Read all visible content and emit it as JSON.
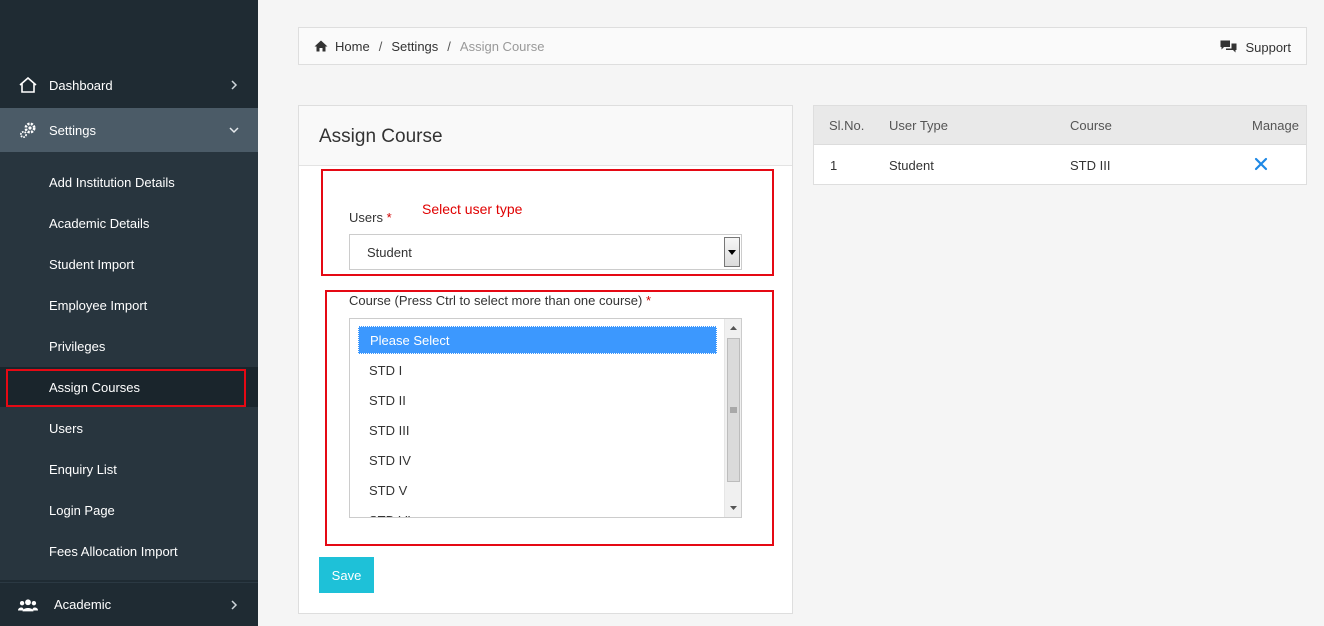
{
  "sidebar": {
    "dashboard": "Dashboard",
    "settings": "Settings",
    "submenu": [
      "Add Institution Details",
      "Academic Details",
      "Student Import",
      "Employee Import",
      "Privileges",
      "Assign Courses",
      "Users",
      "Enquiry List",
      "Login Page",
      "Fees Allocation Import"
    ],
    "academic": "Academic"
  },
  "breadcrumb": {
    "home": "Home",
    "settings": "Settings",
    "current": "Assign Course",
    "support": "Support"
  },
  "form": {
    "title": "Assign Course",
    "users_label": "Users",
    "required_mark": "*",
    "select_hint": "Select user type",
    "users_value": "Student",
    "course_label": "Course (Press Ctrl to select more than one course)",
    "course_options": [
      "Please Select",
      "STD I",
      "STD II",
      "STD III",
      "STD IV",
      "STD V",
      "STD VI"
    ],
    "selected_option": "Please Select",
    "save": "Save"
  },
  "table": {
    "headers": [
      "Sl.No.",
      "User Type",
      "Course",
      "Manage"
    ],
    "rows": [
      {
        "sl": "1",
        "user_type": "Student",
        "course": "STD III"
      }
    ]
  },
  "colors": {
    "sidebar_bg": "#1f2b33",
    "active_menu_bg": "#4b5b67",
    "highlight_red": "#e50914",
    "save_button": "#1ec1d8",
    "selected_option": "#3c98fe",
    "delete_icon": "#1e88e5"
  },
  "icons": {
    "dashboard": "home-outline-icon",
    "settings": "gears-icon",
    "academic": "users-group-icon",
    "breadcrumb_home": "home-icon",
    "support": "chat-bubbles-icon",
    "manage": "close-icon"
  }
}
